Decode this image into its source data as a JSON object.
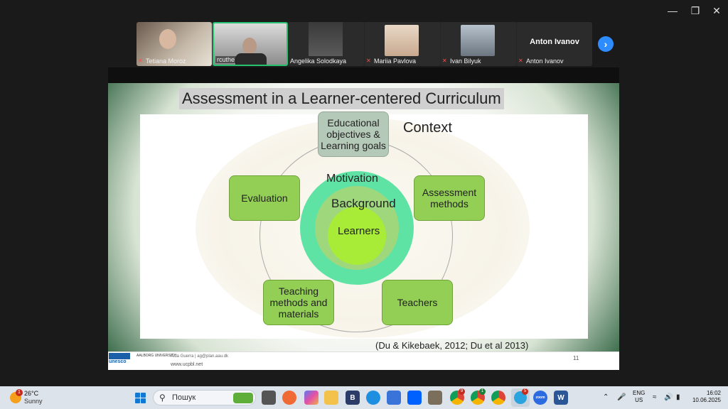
{
  "window": {
    "minimize_glyph": "—",
    "restore_glyph": "❐",
    "close_glyph": "✕"
  },
  "participants": [
    {
      "name": "Tetiana Moroz",
      "muted": true
    },
    {
      "name": "rcuthe",
      "muted": false,
      "active": true
    },
    {
      "name": "Angelika Solodkaya",
      "muted": false
    },
    {
      "name": "Mariia Pavlova",
      "muted": true
    },
    {
      "name": "Ivan Bilyuk",
      "muted": true
    },
    {
      "name": "Anton Ivanov",
      "muted": true,
      "title": "Anton Ivanov"
    }
  ],
  "next_glyph": "›",
  "slide": {
    "title": "Assessment in a  Learner-centered Curriculum",
    "context": "Context",
    "motivation": "Motivation",
    "background": "Background",
    "learners": "Learners",
    "boxes": {
      "objectives": "Educational objectives & Learning goals",
      "assessment": "Assessment methods",
      "teachers": "Teachers",
      "teaching": "Teaching methods and materials",
      "evaluation": "Evaluation"
    },
    "citation": "(Du & Kikebaek, 2012; Du et al 2013)",
    "footer": {
      "unesco": "unesco",
      "aalborg": "AALBORG UNIVERSITY",
      "contact": "Aida Guerra | ag@plan.aau.dk",
      "web": "www.ucpbl.net",
      "page": "11"
    }
  },
  "taskbar": {
    "weather_badge": "1",
    "temperature": "26°C",
    "condition": "Sunny",
    "search_placeholder": "Пошук",
    "app_b_letter": "B",
    "chrome_badge_1": "9",
    "chrome_badge_2": "1",
    "telegram_badge": "5",
    "zoom_label": "zoom",
    "word_letter": "W",
    "lang_top": "ENG",
    "lang_bottom": "US",
    "time": "16:02",
    "date": "10.06.2025"
  },
  "colors": {
    "accent_green": "#92cf54",
    "active_border": "#25c16f",
    "next_button": "#2d8cff"
  }
}
